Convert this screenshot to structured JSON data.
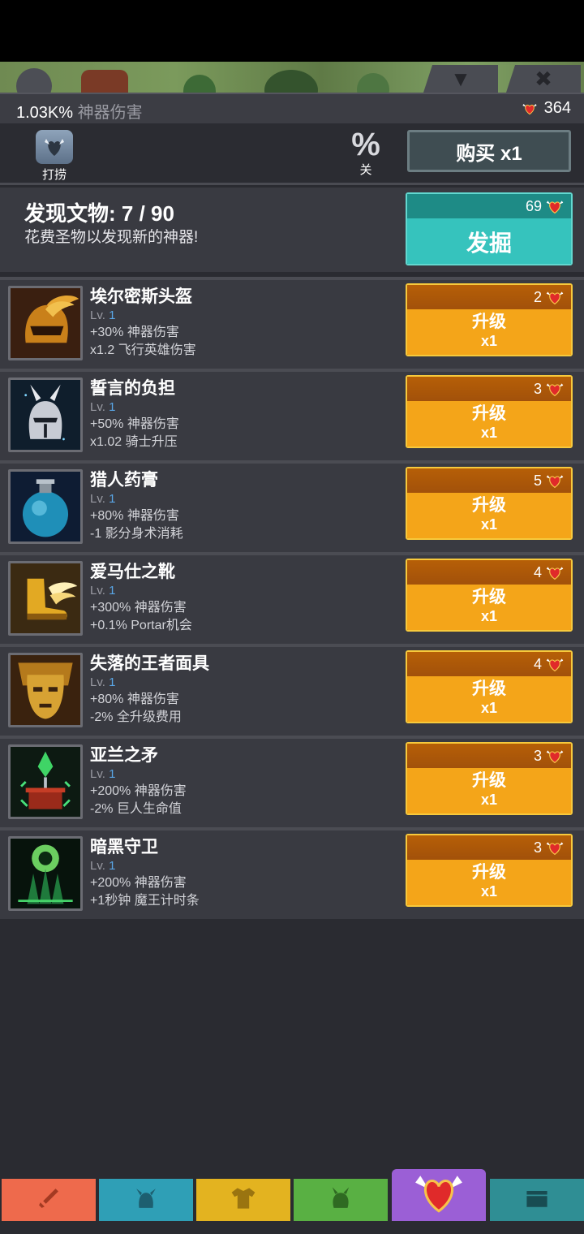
{
  "header": {
    "damage_value": "1.03K%",
    "damage_label": "神器伤害",
    "relics": "364"
  },
  "toolbar": {
    "fish_label": "打捞",
    "percent_symbol": "%",
    "percent_label": "关",
    "buy_label": "购买 x1"
  },
  "discover": {
    "title": "发现文物: 7 / 90",
    "subtitle": "花费圣物以发现新的神器!",
    "cost": "69",
    "button_label": "发掘"
  },
  "artifacts": [
    {
      "name": "埃尔密斯头盔",
      "lv_prefix": "Lv.",
      "lv": "1",
      "effect1": "+30% 神器伤害",
      "effect2": "x1.2 飞行英雄伤害",
      "cost": "2",
      "btn_l1": "升级",
      "btn_l2": "x1",
      "icon": "winged-helmet-icon"
    },
    {
      "name": "誓言的负担",
      "lv_prefix": "Lv.",
      "lv": "1",
      "effect1": "+50% 神器伤害",
      "effect2": "x1.02 骑士升压",
      "cost": "3",
      "btn_l1": "升级",
      "btn_l2": "x1",
      "icon": "knight-helmet-icon"
    },
    {
      "name": "猎人药膏",
      "lv_prefix": "Lv.",
      "lv": "1",
      "effect1": "+80% 神器伤害",
      "effect2": "-1 影分身术消耗",
      "cost": "5",
      "btn_l1": "升级",
      "btn_l2": "x1",
      "icon": "potion-flask-icon"
    },
    {
      "name": "爱马仕之靴",
      "lv_prefix": "Lv.",
      "lv": "1",
      "effect1": "+300% 神器伤害",
      "effect2": "+0.1% Portar机会",
      "cost": "4",
      "btn_l1": "升级",
      "btn_l2": "x1",
      "icon": "winged-boots-icon"
    },
    {
      "name": "失落的王者面具",
      "lv_prefix": "Lv.",
      "lv": "1",
      "effect1": "+80% 神器伤害",
      "effect2": "-2% 全升级费用",
      "cost": "4",
      "btn_l1": "升级",
      "btn_l2": "x1",
      "icon": "golden-mask-icon"
    },
    {
      "name": "亚兰之矛",
      "lv_prefix": "Lv.",
      "lv": "1",
      "effect1": "+200% 神器伤害",
      "effect2": "-2% 巨人生命值",
      "cost": "3",
      "btn_l1": "升级",
      "btn_l2": "x1",
      "icon": "emerald-spear-icon"
    },
    {
      "name": "暗黑守卫",
      "lv_prefix": "Lv.",
      "lv": "1",
      "effect1": "+200% 神器伤害",
      "effect2": "+1秒钟 魔王计时条",
      "cost": "3",
      "btn_l1": "升级",
      "btn_l2": "x1",
      "icon": "dark-guardian-icon"
    }
  ],
  "nav_tabs": [
    {
      "icon": "sword-icon",
      "color": "#ee6a4c"
    },
    {
      "icon": "viking-helmet-icon",
      "color": "#2f9fb6"
    },
    {
      "icon": "shirt-icon",
      "color": "#e3b320"
    },
    {
      "icon": "horned-helmet-icon",
      "color": "#59b043"
    },
    {
      "icon": "winged-heart-icon",
      "color": "#9b5fd6",
      "active": true
    },
    {
      "icon": "chest-icon",
      "color": "#2f8e94"
    }
  ]
}
